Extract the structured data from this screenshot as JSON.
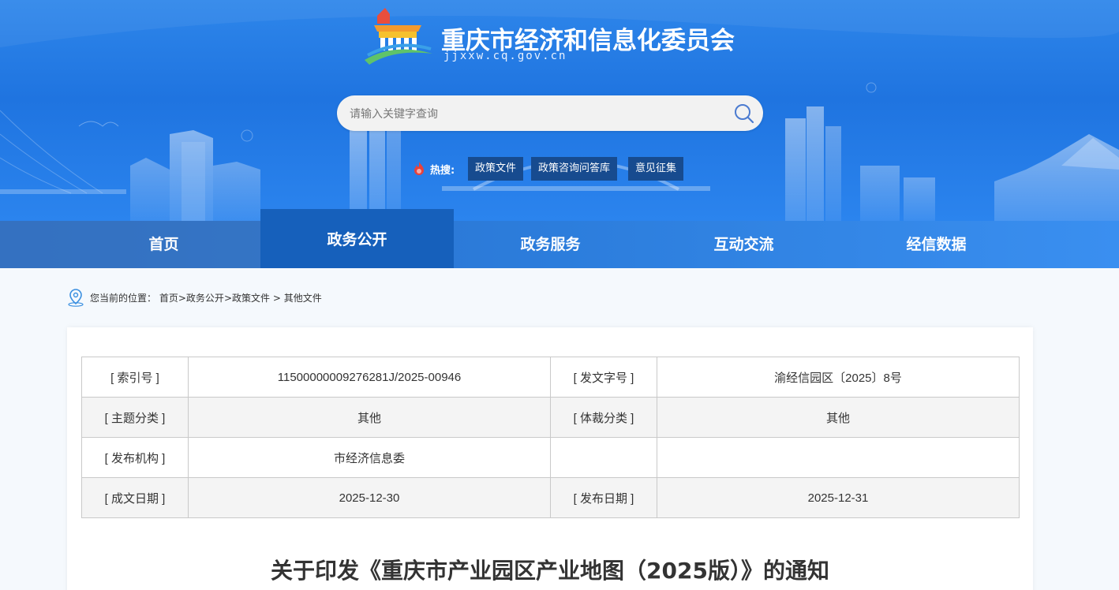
{
  "site": {
    "title": "重庆市经济和信息化委员会",
    "domain": "jjxxw.cq.gov.cn"
  },
  "search": {
    "placeholder": "请输入关键字查询"
  },
  "hot_search": {
    "label": "热搜:",
    "tags": [
      "政策文件",
      "政策咨询问答库",
      "意见征集"
    ]
  },
  "nav": {
    "items": [
      "首页",
      "政务公开",
      "政务服务",
      "互动交流",
      "经信数据"
    ],
    "active": "政务公开"
  },
  "breadcrumb": {
    "prefix": "您当前的位置：",
    "items": [
      "首页",
      "政务公开",
      "政策文件",
      "其他文件"
    ]
  },
  "meta": {
    "rows": [
      [
        "[ 索引号 ]",
        "11500000009276281J/2025-00946",
        "[ 发文字号 ]",
        "渝经信园区〔2025〕8号"
      ],
      [
        "[ 主题分类 ]",
        "其他",
        "[ 体裁分类 ]",
        "其他"
      ],
      [
        "[ 发布机构 ]",
        "市经济信息委",
        "",
        ""
      ],
      [
        "[ 成文日期 ]",
        "2025-12-30",
        "[ 发布日期 ]",
        "2025-12-31"
      ]
    ]
  },
  "document": {
    "title": "关于印发《重庆市产业园区产业地图（2025版）》的通知"
  },
  "colors": {
    "header_blue": "#1f74e0",
    "nav_active": "#1660bb",
    "hot_tag_bg": "#174b8f"
  }
}
